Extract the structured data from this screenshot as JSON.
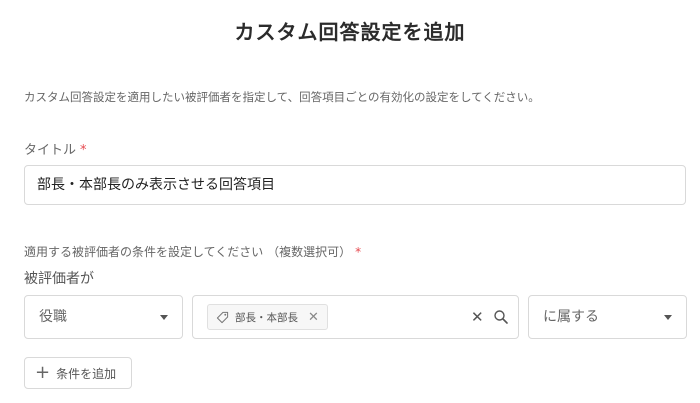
{
  "page": {
    "title": "カスタム回答設定を追加",
    "description": "カスタム回答設定を適用したい被評価者を指定して、回答項目ごとの有効化の設定をしてください。"
  },
  "form": {
    "title_label": "タイトル",
    "required_mark": "*",
    "title_value": "部長・本部長のみ表示させる回答項目",
    "conditions_label": "適用する被評価者の条件を設定してください （複数選択可）",
    "subject_label": "被評価者が",
    "condition": {
      "field": "役職",
      "tag": "部長・本部長",
      "operator": "に属する"
    },
    "add_condition_label": "条件を追加"
  },
  "colors": {
    "required": "#e6494f",
    "border": "#d9d9d9"
  },
  "icons": [
    "tag-icon",
    "close-icon",
    "clear-icon",
    "search-icon",
    "chevron-down-icon",
    "plus-icon"
  ]
}
